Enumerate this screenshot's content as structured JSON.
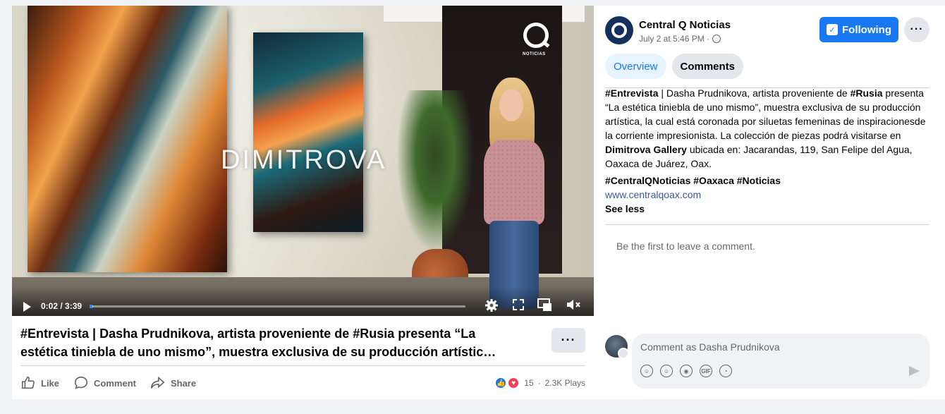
{
  "video": {
    "watermark": "DIMITROVA",
    "logo_label": "NOTICIAS",
    "time": "0:02 / 3:39",
    "progress_fraction": 0.01
  },
  "post": {
    "title_line1": "#Entrevista | Dasha Prudnikova, artista proveniente de #Rusia presenta “La",
    "title_line2": "estética tiniebla de uno mismo”, muestra exclusiva de su producción artístic…",
    "more_label": "···",
    "actions": {
      "like": "Like",
      "comment": "Comment",
      "share": "Share"
    },
    "reaction_count": "15",
    "plays": "2.3K Plays"
  },
  "sidebar": {
    "page_name": "Central Q Noticias",
    "post_time": "July 2 at 5:46 PM ·",
    "follow_label": "Following",
    "dots_label": "···",
    "tabs": [
      {
        "label": "Overview"
      },
      {
        "label": "Comments"
      }
    ],
    "body": {
      "p1_tag": "#Entrevista",
      "p1_a": " | Dasha Prudnikova, artista proveniente de ",
      "p1_tag2": "#Rusia",
      "p1_b": " presenta “La estética tiniebla de uno mismo”, muestra exclusiva de su producción artística, la cual está coronada por siluetas femeninas de inspiracionesde la corriente impresionista. La colección de piezas podrá visitarse en ",
      "p1_bold": "Dimitrova Gallery",
      "p1_c": " ubicada en: Jacarandas, 119, San Felipe del Agua, Oaxaca de Juárez, Oax."
    },
    "hashtags": "#CentralQNoticias #Oaxaca #Noticias",
    "link": "www.centralqoax.com",
    "see_less": "See less",
    "empty_comments": "Be the first to leave a comment.",
    "comment_placeholder": "Comment as Dasha Prudnikova",
    "comment_icons": [
      "avatar-sticker-icon",
      "emoji-icon",
      "camera-icon",
      "gif-icon",
      "sticker-icon"
    ],
    "gif_label": "GIF"
  },
  "colors": {
    "brand_blue": "#1877f2",
    "love_red": "#f33e58",
    "link": "#385898"
  }
}
